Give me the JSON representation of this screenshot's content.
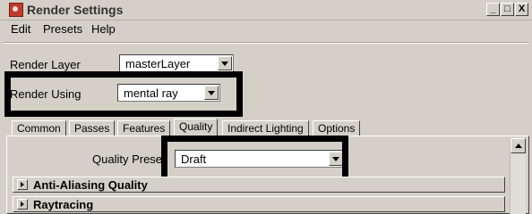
{
  "window": {
    "title": "Render Settings",
    "controls": {
      "minimize": "_",
      "maximize": "□",
      "close": "X"
    }
  },
  "menubar": {
    "items": [
      "Edit",
      "Presets",
      "Help"
    ]
  },
  "render_layer": {
    "label": "Render Layer",
    "value": "masterLayer"
  },
  "render_using": {
    "label": "Render Using",
    "value": "mental ray"
  },
  "tabs": [
    {
      "label": "Common",
      "active": false
    },
    {
      "label": "Passes",
      "active": false
    },
    {
      "label": "Features",
      "active": false
    },
    {
      "label": "Quality",
      "active": true
    },
    {
      "label": "Indirect Lighting",
      "active": false
    },
    {
      "label": "Options",
      "active": false
    }
  ],
  "quality": {
    "preset_label": "Quality Preset",
    "preset_value": "Draft",
    "sections": [
      {
        "title": "Anti-Aliasing Quality"
      },
      {
        "title": "Raytracing"
      }
    ]
  }
}
